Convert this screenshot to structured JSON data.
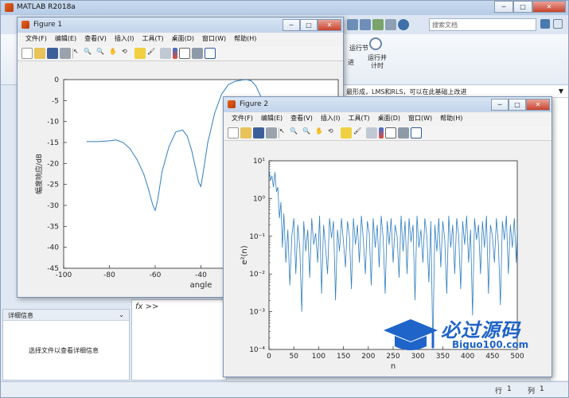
{
  "matlab": {
    "title": "MATLAB R2018a",
    "search_placeholder": "搜索文档",
    "ribbon_run_section": "运行节",
    "ribbon_run_section_sub": "进",
    "ribbon_run_timer": "运行并计时",
    "editor_line": "最形成，LMS和RLS，可以在此基础上改进",
    "details_title": "详细信息",
    "details_body": "选择文件以查看详细信息",
    "fx_prompt": "fx  >>",
    "status_row_label": "行",
    "status_row": "1",
    "status_col_label": "列",
    "status_col": "1"
  },
  "figure1": {
    "title": "Figure 1",
    "menu": [
      "文件(F)",
      "编辑(E)",
      "查看(V)",
      "插入(I)",
      "工具(T)",
      "桌面(D)",
      "窗口(W)",
      "帮助(H)"
    ]
  },
  "figure2": {
    "title": "Figure 2",
    "menu": [
      "文件(F)",
      "编辑(E)",
      "查看(V)",
      "插入(I)",
      "工具(T)",
      "桌面(D)",
      "窗口(W)",
      "帮助(H)"
    ]
  },
  "watermark": {
    "cn": "必过源码",
    "en": "Biguo100.com"
  },
  "chart_data": [
    {
      "type": "line",
      "title": "",
      "xlabel": "angle",
      "ylabel": "幅度响应/dB",
      "xlim": [
        -100,
        20
      ],
      "ylim": [
        -45,
        0
      ],
      "xticks": [
        -100,
        -80,
        -60,
        -40,
        -20,
        0,
        20
      ],
      "yticks": [
        0,
        -5,
        -10,
        -15,
        -20,
        -25,
        -30,
        -35,
        -40,
        -45
      ],
      "color": "#2f7ebf",
      "series": [
        {
          "x": [
            -90,
            -85,
            -80,
            -77,
            -74,
            -71,
            -68,
            -65,
            -63,
            -61,
            -60,
            -59,
            -57,
            -54,
            -51,
            -48,
            -46,
            -44,
            -42,
            -41,
            -40,
            -39,
            -37,
            -34,
            -31,
            -28,
            -25,
            -22,
            -20,
            -18,
            -16,
            -13,
            -10,
            -7,
            -4,
            -2,
            -1,
            0,
            1,
            2,
            4,
            6,
            8,
            10,
            12,
            14,
            16,
            18,
            19,
            20,
            21,
            22
          ],
          "y": [
            -14.8,
            -14.8,
            -14.6,
            -14.4,
            -15,
            -16.5,
            -19,
            -22.5,
            -26,
            -30,
            -31.2,
            -29,
            -22,
            -16,
            -12.5,
            -12,
            -13.5,
            -17,
            -22,
            -24.5,
            -25.5,
            -22,
            -15,
            -8,
            -3.5,
            -1.2,
            -0.4,
            -0.1,
            0,
            -0.3,
            -1.5,
            -5,
            -10,
            -17,
            -23,
            -29,
            -31.5,
            -31.2,
            -29,
            -24,
            -18,
            -15,
            -14,
            -14.5,
            -17,
            -22,
            -28,
            -35,
            -40,
            -41.5,
            -38,
            -30
          ]
        }
      ]
    },
    {
      "type": "line",
      "title": "",
      "xlabel": "n",
      "ylabel": "e²(n)",
      "xlim": [
        0,
        500
      ],
      "ylim": [
        0.0001,
        10
      ],
      "yscale": "log",
      "xticks": [
        0,
        50,
        100,
        150,
        200,
        250,
        300,
        350,
        400,
        450,
        500
      ],
      "yticks": [
        "10¹",
        "10⁰",
        "10⁻¹",
        "10⁻²",
        "10⁻³",
        "10⁻⁴"
      ],
      "color": "#2f7ebf",
      "series": [
        {
          "x": [
            0,
            3,
            6,
            9,
            12,
            15,
            18,
            21,
            24,
            27,
            30,
            34,
            38,
            42,
            46,
            50,
            54,
            58,
            62,
            66,
            70,
            74,
            78,
            82,
            86,
            90,
            94,
            98,
            102,
            106,
            110,
            114,
            118,
            122,
            126,
            130,
            134,
            138,
            142,
            146,
            150,
            154,
            158,
            162,
            166,
            170,
            174,
            178,
            182,
            186,
            190,
            194,
            198,
            202,
            206,
            210,
            214,
            218,
            222,
            226,
            230,
            234,
            238,
            242,
            246,
            250,
            254,
            258,
            262,
            266,
            270,
            274,
            278,
            282,
            286,
            290,
            294,
            298,
            302,
            306,
            310,
            314,
            318,
            322,
            326,
            330,
            334,
            338,
            342,
            346,
            350,
            354,
            358,
            362,
            366,
            370,
            374,
            378,
            382,
            386,
            390,
            394,
            398,
            402,
            406,
            410,
            414,
            418,
            422,
            426,
            430,
            434,
            438,
            442,
            446,
            450,
            454,
            458,
            462,
            466,
            470,
            474,
            478,
            482,
            486,
            490,
            494,
            498,
            500
          ],
          "y": [
            6,
            3,
            4,
            2,
            5,
            1.5,
            2,
            0.3,
            0.8,
            0.05,
            0.4,
            0.02,
            0.15,
            0.005,
            0.1,
            0.3,
            0.01,
            0.2,
            0.05,
            0.001,
            0.25,
            0.04,
            0.15,
            0.008,
            0.3,
            0.06,
            0.12,
            0.02,
            0.35,
            0.003,
            0.2,
            0.05,
            0.01,
            0.3,
            0.09,
            0.25,
            0.002,
            0.15,
            0.04,
            0.3,
            0.07,
            0.015,
            0.25,
            0.1,
            0.004,
            0.3,
            0.06,
            0.2,
            0.02,
            0.35,
            0.08,
            0.01,
            0.25,
            0.12,
            0.005,
            0.3,
            0.05,
            0.2,
            0.015,
            0.35,
            0.09,
            0.003,
            0.25,
            0.06,
            0.3,
            0.02,
            0.2,
            0.1,
            0.008,
            0.35,
            0.04,
            0.25,
            0.01,
            0.3,
            0.07,
            0.2,
            0.002,
            0.35,
            0.05,
            0.15,
            0.02,
            0.3,
            0.1,
            0.006,
            0.25,
            0.0001,
            0.2,
            0.04,
            0.3,
            0.015,
            0.25,
            0.08,
            0.003,
            0.35,
            0.05,
            0.2,
            0.01,
            0.3,
            0.1,
            0.004,
            0.25,
            0.06,
            0.35,
            0.02,
            0.15,
            0.0008,
            0.3,
            0.08,
            0.2,
            0.01,
            0.25,
            0.05,
            0.35,
            0.003,
            0.2,
            0.1,
            0.02,
            0.3,
            0.06,
            0.0015,
            0.25,
            0.08,
            0.35,
            0.01,
            0.2,
            0.05,
            0.3,
            0.02,
            0.15
          ]
        }
      ]
    }
  ]
}
